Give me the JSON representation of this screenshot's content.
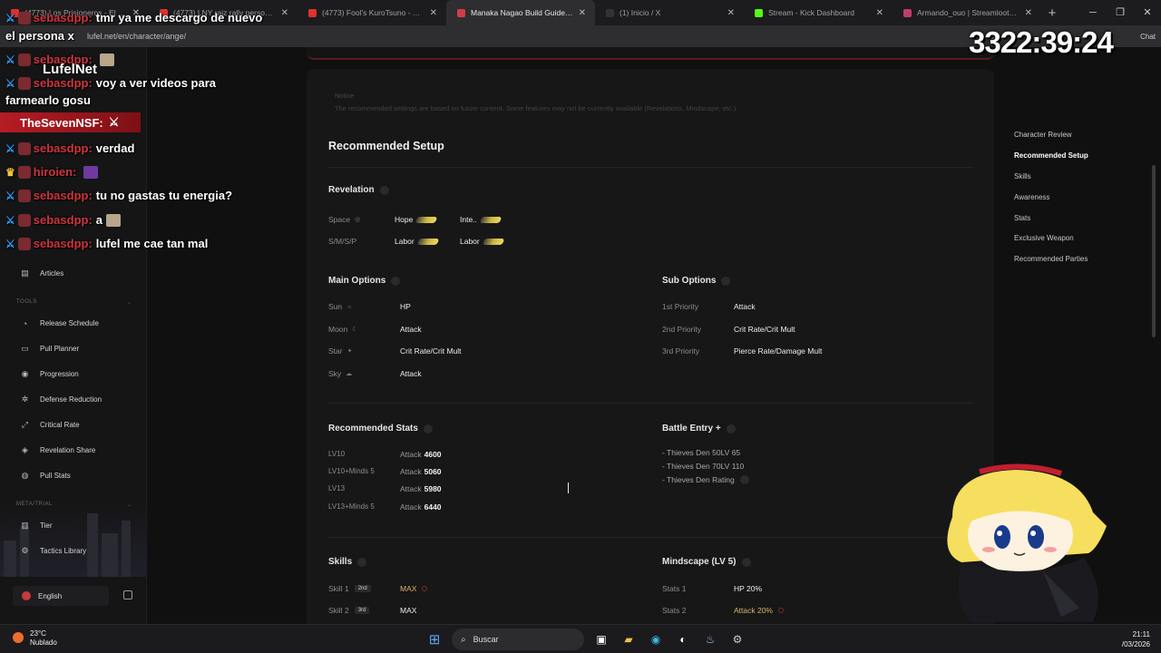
{
  "browser": {
    "tabs": [
      {
        "title": "(4773) Los Prisioneros - El Ba",
        "color": "#e0312e",
        "active": false
      },
      {
        "title": "(4773) LNY raiz rally persona 5 x",
        "color": "#e0312e",
        "active": false
      },
      {
        "title": "(4773) Fool's KuroTsuno - YouTube",
        "color": "#e0312e",
        "active": false
      },
      {
        "title": "Manaka Nagao Build Guide | Lufel",
        "color": "#d23c4a",
        "active": true
      },
      {
        "title": "(1) Inicio / X",
        "color": "#333333",
        "active": false
      },
      {
        "title": "Stream - Kick Dashboard",
        "color": "#53fc18",
        "active": false
      },
      {
        "title": "Armando_ouo | Streamloots | Inte",
        "color": "#c03c6a",
        "active": false
      }
    ],
    "url": "lufel.net/en/character/ange/",
    "chat_label": "Chat"
  },
  "sidebar": {
    "items": [
      {
        "label": "Articles",
        "icon": "doc-icon"
      }
    ],
    "tools_title": "TOOLS",
    "tools": [
      {
        "label": "Release Schedule",
        "icon": "calendar-icon"
      },
      {
        "label": "Pull Planner",
        "icon": "planner-icon"
      },
      {
        "label": "Progression",
        "icon": "progress-icon"
      },
      {
        "label": "Defense Reduction",
        "icon": "shield-icon"
      },
      {
        "label": "Critical Rate",
        "icon": "target-icon"
      },
      {
        "label": "Revelation Share",
        "icon": "share-icon"
      },
      {
        "label": "Pull Stats",
        "icon": "stats-icon"
      }
    ],
    "meta_title": "META/TRIAL",
    "meta": [
      {
        "label": "Tier",
        "icon": "tier-icon"
      },
      {
        "label": "Tactics Library",
        "icon": "library-icon"
      }
    ],
    "language": "English"
  },
  "content": {
    "notice_title": "Notice",
    "notice_text": "The recommended settings are based on future content. Some features may not be currently available (Revelations, Mindscape, etc.)",
    "setup_title": "Recommended Setup",
    "revelation": {
      "title": "Revelation",
      "rows": [
        {
          "label": "Space",
          "a": "Hope",
          "b": "Inte.."
        },
        {
          "label": "S/M/S/P",
          "a": "Labor",
          "b": "Labor"
        }
      ]
    },
    "main_options": {
      "title": "Main Options",
      "rows": [
        {
          "label": "Sun",
          "icon": "sun-icon",
          "value": "HP"
        },
        {
          "label": "Moon",
          "icon": "moon-icon",
          "value": "Attack"
        },
        {
          "label": "Star",
          "icon": "star-icon",
          "value": "Crit Rate/Crit Mult"
        },
        {
          "label": "Sky",
          "icon": "sky-icon",
          "value": "Attack"
        }
      ]
    },
    "sub_options": {
      "title": "Sub Options",
      "rows": [
        {
          "label": "1st Priority",
          "value": "Attack"
        },
        {
          "label": "2nd Priority",
          "value": "Crit Rate/Crit Mult"
        },
        {
          "label": "3rd Priority",
          "value": "Pierce Rate/Damage Mult"
        }
      ]
    },
    "recommended_stats": {
      "title": "Recommended Stats",
      "rows": [
        {
          "label": "LV10",
          "stat": "Attack",
          "value": "4600"
        },
        {
          "label": "LV10+Minds 5",
          "stat": "Attack",
          "value": "5060"
        },
        {
          "label": "LV13",
          "stat": "Attack",
          "value": "5980"
        },
        {
          "label": "LV13+Minds 5",
          "stat": "Attack",
          "value": "6440"
        }
      ]
    },
    "battle_entry": {
      "title": "Battle Entry +",
      "rows": [
        "- Thieves Den 50LV 65",
        "- Thieves Den 70LV 110",
        "- Thieves Den Rating"
      ]
    },
    "skills": {
      "title": "Skills",
      "rows": [
        {
          "label": "Skill 1",
          "badge": "2nd",
          "value": "MAX"
        },
        {
          "label": "Skill 2",
          "badge": "3rd",
          "value": "MAX"
        }
      ]
    },
    "mindscape": {
      "title": "Mindscape (LV 5)",
      "rows": [
        {
          "label": "Stats 1",
          "value": "HP 20%"
        },
        {
          "label": "Stats 2",
          "value": "Attack 20%"
        }
      ]
    }
  },
  "toc": [
    {
      "label": "Character Review",
      "active": false
    },
    {
      "label": "Recommended Setup",
      "active": true
    },
    {
      "label": "Skills",
      "active": false
    },
    {
      "label": "Awareness",
      "active": false
    },
    {
      "label": "Stats",
      "active": false
    },
    {
      "label": "Exclusive Weapon",
      "active": false
    },
    {
      "label": "Recommended Parties",
      "active": false
    }
  ],
  "overlay": {
    "timer": "3322:39:24",
    "logo": "LufelNet",
    "banner": "TheSevenNSF:",
    "chat": [
      {
        "user": "sebasdpp:",
        "text": "tmr ya me descargo de nuevo"
      },
      {
        "user": "",
        "text": "el persona x"
      },
      {
        "user": "sebasdpp:",
        "text": ""
      },
      {
        "user": "sebasdpp:",
        "text": "voy a ver videos para"
      },
      {
        "user": "",
        "text": "farmearlo gosu"
      },
      {
        "user": "sebasdpp:",
        "text": "verdad"
      },
      {
        "user": "hiroien:",
        "text": ""
      },
      {
        "user": "sebasdpp:",
        "text": "tu no gastas tu energia?"
      },
      {
        "user": "sebasdpp:",
        "text": "a"
      },
      {
        "user": "sebasdpp:",
        "text": "lufel me cae tan mal"
      }
    ]
  },
  "taskbar": {
    "temp": "23°C",
    "weather": "Nublado",
    "search": "Buscar",
    "time": "21:11",
    "date": "/03/2026"
  }
}
